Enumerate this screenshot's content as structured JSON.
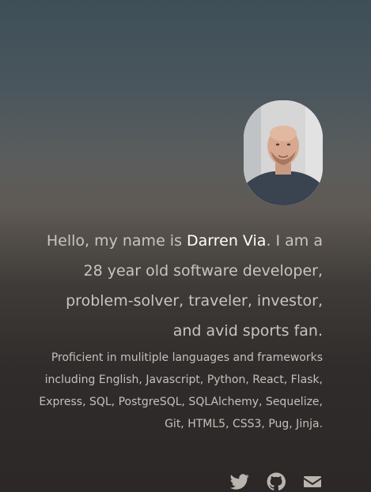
{
  "profile": {
    "avatar_alt": "profile photo",
    "intro_before": "Hello, my name is ",
    "name": "Darren Via",
    "intro_after": ". I am a 28 year old software developer, problem-solver, traveler, investor, and avid sports fan.",
    "skills": "Proficient in mulitiple languages and frameworks including English, Javascript, Python, React, Flask, Express, SQL, PostgreSQL, SQLAlchemy, Sequelize, Git, HTML5, CSS3, Pug, Jinja."
  },
  "socials": [
    {
      "icon": "twitter-icon"
    },
    {
      "icon": "github-icon"
    },
    {
      "icon": "email-icon"
    }
  ],
  "colors": {
    "text": "#c8c4bf",
    "highlight": "#ffffff",
    "icon": "#b9b4ae"
  }
}
